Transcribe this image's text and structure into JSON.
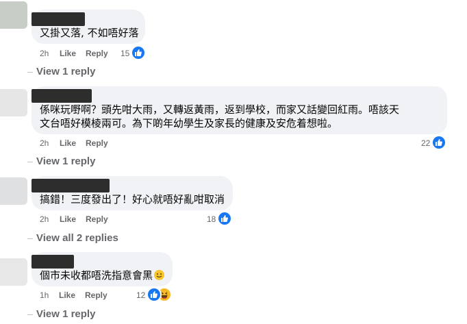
{
  "comments": [
    {
      "text": "又掛又落, 不如唔好落",
      "time": "2h",
      "like_label": "Like",
      "reply_label": "Reply",
      "reaction_count": "15",
      "reactions": [
        "like-icon"
      ],
      "view_replies": "View 1 reply"
    },
    {
      "text_line1": "係咪玩嘢啊？頭先咁大雨，又轉返黃雨，返到學校，而家又話變回紅雨。唔該天",
      "text_line2": "文台唔好模棱兩可。為下啲年幼學生及家長的健康及安危着想啦。",
      "time": "2h",
      "like_label": "Like",
      "reply_label": "Reply",
      "reaction_count": "22",
      "reactions": [
        "like-icon"
      ],
      "view_replies": "View 1 reply"
    },
    {
      "text": "搞錯！三度發出了！好心就唔好亂咁取消",
      "time": "2h",
      "like_label": "Like",
      "reply_label": "Reply",
      "reaction_count": "18",
      "reactions": [
        "like-icon"
      ],
      "view_replies": "View all 2 replies"
    },
    {
      "text": "個市未收都唔洗指意會黑",
      "time": "1h",
      "like_label": "Like",
      "reply_label": "Reply",
      "reaction_count": "12",
      "reactions": [
        "like-icon",
        "haha-icon"
      ],
      "view_replies": "View 1 reply"
    }
  ],
  "colors": {
    "bubble": "#f0f2f5",
    "meta": "#65676b",
    "like": "#1877f2",
    "haha": "#f7b928",
    "redacted_name": "#2d2d2d"
  }
}
